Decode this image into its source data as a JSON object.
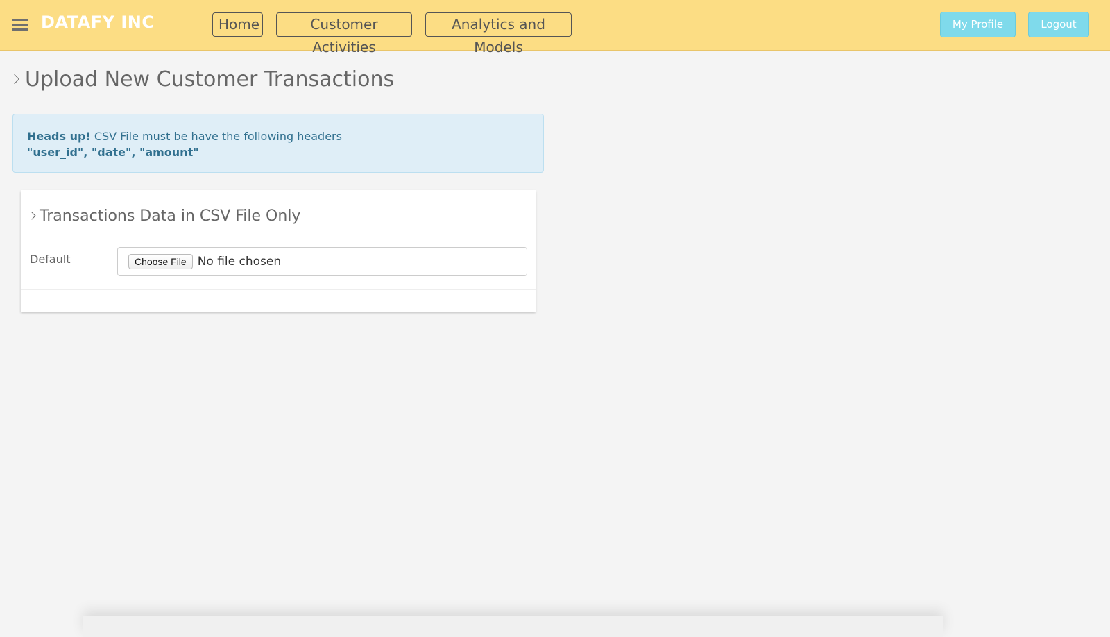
{
  "navbar": {
    "brand": "DATAFY INC",
    "menu_icon": "hamburger-menu-icon",
    "links": [
      {
        "label": "Home"
      },
      {
        "label": "Customer Activities"
      },
      {
        "label": "Analytics and Models"
      }
    ],
    "profile_label": "My Profile",
    "logout_label": "Logout"
  },
  "page": {
    "title": "Upload New Customer Transactions",
    "title_icon": "chevron-right-icon"
  },
  "alert": {
    "strong": "Heads up!",
    "message": " CSV File must be have the following headers",
    "headers": "\"user_id\", \"date\", \"amount\""
  },
  "upload_card": {
    "title": "Transactions Data in CSV File Only",
    "field_label": "Default",
    "choose_button": "Choose File",
    "file_status": "No file chosen"
  },
  "colors": {
    "navbar_bg": "#fcdd84",
    "button_accent": "#7fdaeb",
    "alert_bg": "#dfeef7",
    "alert_text": "#31708f",
    "page_bg": "#f4f4f4"
  }
}
